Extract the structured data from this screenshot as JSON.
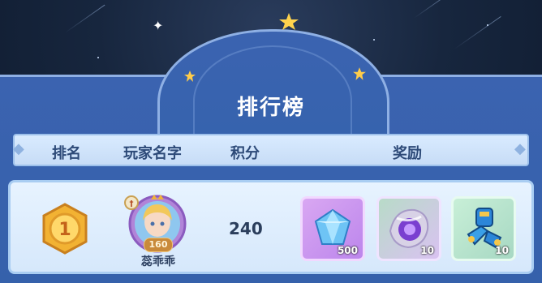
{
  "leaderboard": {
    "title": "排行榜",
    "headers": {
      "rank": "排名",
      "player_name": "玩家名字",
      "score": "积分",
      "rewards": "奖励"
    },
    "entry": {
      "rank": 1,
      "rank_text": "1",
      "player_name": "蕊乖乖",
      "level": "160",
      "score": "240",
      "rewards": [
        {
          "icon": "blue-diamond-icon",
          "quantity": "500"
        },
        {
          "icon": "purple-orb-icon",
          "quantity": "10"
        },
        {
          "icon": "blue-armor-gauntlet-icon",
          "quantity": "10"
        }
      ]
    }
  },
  "colors": {
    "panel": "#3561ab",
    "header_bar": "#d9ebff",
    "row_card": "#e7f3ff",
    "medal_gold": "#f2b233",
    "moon": "#ffd27a"
  }
}
